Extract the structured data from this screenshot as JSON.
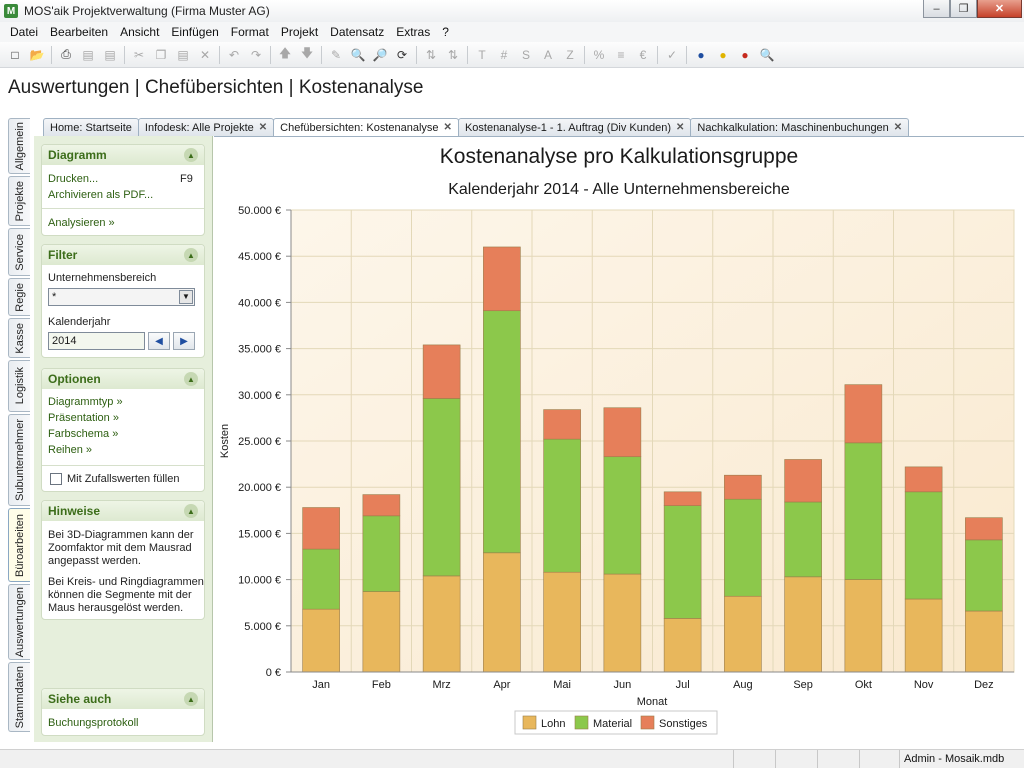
{
  "window": {
    "title": "MOS'aik Projektverwaltung (Firma Muster AG)"
  },
  "menu": [
    "Datei",
    "Bearbeiten",
    "Ansicht",
    "Einfügen",
    "Format",
    "Projekt",
    "Datensatz",
    "Extras",
    "?"
  ],
  "page_title": "Auswertungen | Chefübersichten | Kostenanalyse",
  "side_tabs": [
    "Allgemein",
    "Projekte",
    "Service",
    "Regie",
    "Kasse",
    "Logistik",
    "Subunternehmer",
    "Büroarbeiten",
    "Auswertungen",
    "Stammdaten"
  ],
  "doc_tabs": [
    "Home: Startseite",
    "Infodesk: Alle Projekte",
    "Chefübersichten: Kostenanalyse",
    "Kostenanalyse-1 - 1. Auftrag (Div Kunden)",
    "Nachkalkulation: Maschinenbuchungen"
  ],
  "panels": {
    "diagramm": {
      "title": "Diagramm",
      "print": "Drucken...",
      "print_key": "F9",
      "archive": "Archivieren als PDF...",
      "analyze": "Analysieren »"
    },
    "filter": {
      "title": "Filter",
      "unit_label": "Unternehmensbereich",
      "unit_value": "*",
      "year_label": "Kalenderjahr",
      "year_value": "2014"
    },
    "optionen": {
      "title": "Optionen",
      "links": [
        "Diagrammtyp »",
        "Präsentation »",
        "Farbschema »",
        "Reihen »"
      ],
      "random_label": "Mit Zufallswerten füllen"
    },
    "hinweise": {
      "title": "Hinweise",
      "text1": [
        "Bei 3D-Diagrammen kann der",
        "Zoomfaktor mit dem Mausrad",
        "angepasst werden."
      ],
      "text2": [
        "Bei Kreis- und Ringdiagrammen",
        "können die Segmente mit der",
        "Maus herausgelöst werden."
      ]
    },
    "siehe_auch": {
      "title": "Siehe auch",
      "link": "Buchungsprotokoll"
    }
  },
  "chart_data": {
    "type": "bar",
    "stacked": true,
    "title": "Kostenanalyse pro Kalkulationsgruppe",
    "subtitle": "Kalenderjahr 2014 - Alle Unternehmensbereiche",
    "xlabel": "Monat",
    "ylabel": "Kosten",
    "ylim": [
      0,
      50000
    ],
    "yticks": [
      "0 €",
      "5.000 €",
      "10.000 €",
      "15.000 €",
      "20.000 €",
      "25.000 €",
      "30.000 €",
      "35.000 €",
      "40.000 €",
      "45.000 €",
      "50.000 €"
    ],
    "categories": [
      "Jan",
      "Feb",
      "Mrz",
      "Apr",
      "Mai",
      "Jun",
      "Jul",
      "Aug",
      "Sep",
      "Okt",
      "Nov",
      "Dez"
    ],
    "series": [
      {
        "name": "Lohn",
        "color": "#e8b75c",
        "values": [
          6800,
          8700,
          10400,
          12900,
          10800,
          10600,
          5800,
          8200,
          10300,
          10000,
          7900,
          6600
        ]
      },
      {
        "name": "Material",
        "color": "#8cc84b",
        "values": [
          6500,
          8200,
          19200,
          26200,
          14400,
          12700,
          12200,
          10500,
          8100,
          14800,
          11600,
          7700
        ]
      },
      {
        "name": "Sonstiges",
        "color": "#e67f5a",
        "values": [
          4500,
          2300,
          5800,
          6900,
          3200,
          5300,
          1500,
          2600,
          4600,
          6300,
          2700,
          2400
        ]
      }
    ],
    "legend_position": "bottom",
    "grid": true
  },
  "status": {
    "user_db": "Admin - Mosaik.mdb"
  }
}
